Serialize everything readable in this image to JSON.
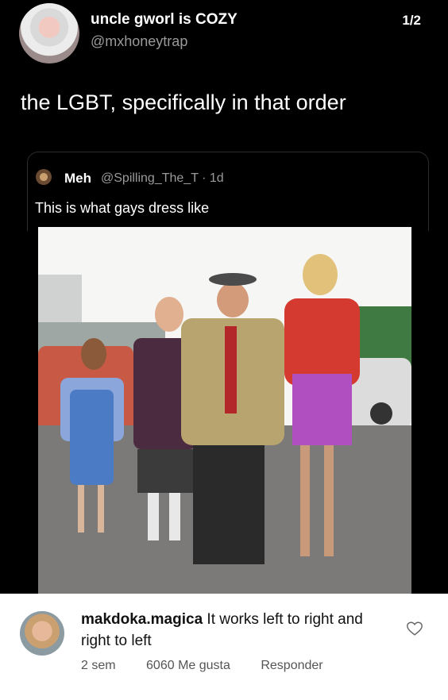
{
  "tweet": {
    "author_name": "uncle gworl is COZY",
    "author_handle": "@mxhoneytrap",
    "page_indicator": "1/2",
    "text": "the LGBT, specifically in that order",
    "quote": {
      "author_name": "Meh",
      "meta": "@Spilling_The_T · 1d",
      "text": "This is what gays dress like"
    }
  },
  "comment": {
    "username": "makdoka.magica",
    "text": "It works left to right and right to left",
    "time": "2 sem",
    "likes": "6060 Me gusta",
    "reply": "Responder",
    "heart_icon": "heart-outline-icon"
  }
}
